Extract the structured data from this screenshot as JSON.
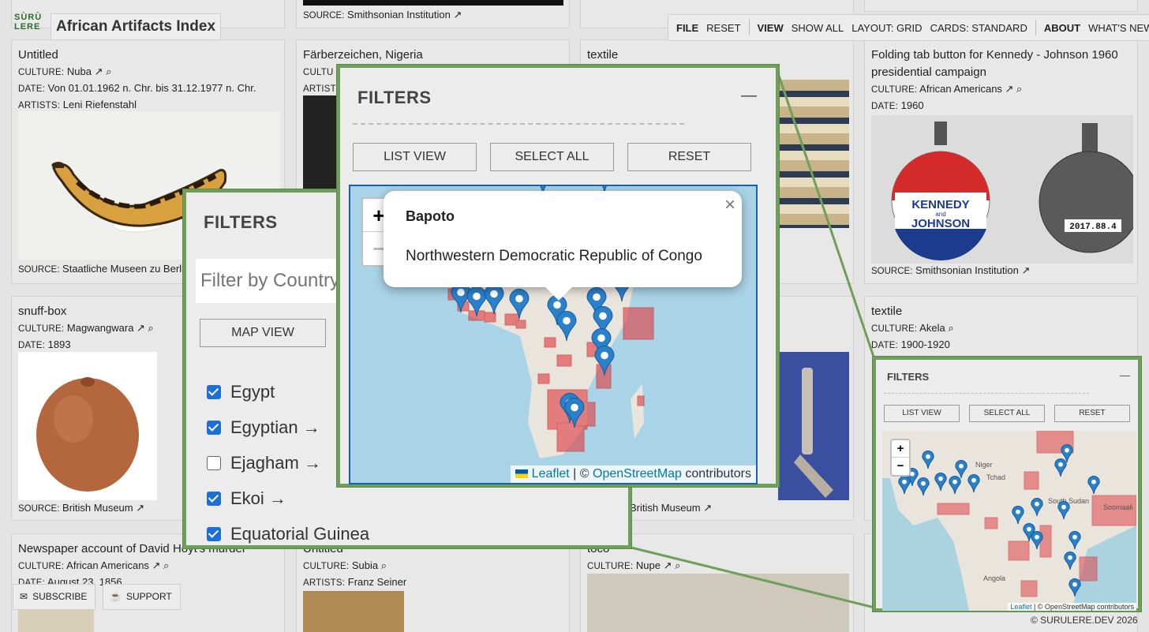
{
  "site": {
    "logo_line1": "SÙRÙ",
    "logo_line2": "LERE",
    "title": "African Artifacts Index"
  },
  "topbar": {
    "file": "FILE",
    "reset": "RESET",
    "view": "VIEW",
    "show_all": "SHOW ALL",
    "layout": "LAYOUT: GRID",
    "cards": "CARDS: STANDARD",
    "about": "ABOUT",
    "whats_new": "WHAT'S NEW"
  },
  "cards": {
    "c1": {
      "title": "Untitled",
      "culture_k": "CULTURE:",
      "culture": "Nuba",
      "date_k": "DATE:",
      "date": "Von 01.01.1962 n. Chr. bis 31.12.1977 n. Chr.",
      "artists_k": "ARTISTS:",
      "artists": "Leni Riefenstahl",
      "source_k": "SOURCE:",
      "source": "Staatliche Museen zu Berlin"
    },
    "c2": {
      "title": "Färberzeichen, Nigeria",
      "culture_k": "CULTU",
      "artists_k": "ARTIST"
    },
    "c3": {
      "title": "textile"
    },
    "c4": {
      "title": "Folding tab button for Kennedy - Johnson 1960 presidential campaign",
      "culture_k": "CULTURE:",
      "culture": "African Americans",
      "date_k": "DATE:",
      "date": "1960",
      "source_k": "SOURCE:",
      "source": "Smithsonian Institution",
      "btn_line1": "KENNEDY",
      "btn_and": "and",
      "btn_line2": "JOHNSON",
      "tag": "2017.88.4"
    },
    "c5": {
      "title": "snuff-box",
      "culture_k": "CULTURE:",
      "culture": "Magwangwara",
      "date_k": "DATE:",
      "date": "1893",
      "source_k": "SOURCE:",
      "source": "British Museum"
    },
    "c6": {
      "source": "British Museum"
    },
    "c7": {
      "title": "textile",
      "culture_k": "CULTURE:",
      "culture": "Akela",
      "date_k": "DATE:",
      "date": "1900-1920"
    },
    "c8": {
      "title": "Newspaper account of David Hoyt's murder",
      "culture_k": "CULTURE:",
      "culture": "African Americans",
      "date_k": "DATE:",
      "date": "August 23, 1856"
    },
    "c9": {
      "title": "Untitled",
      "culture_k": "CULTURE:",
      "culture": "Subia",
      "artists_k": "ARTISTS:",
      "artists": "Franz Seiner"
    },
    "c10": {
      "title": "toco",
      "culture_k": "CULTURE:",
      "culture": "Nupe"
    },
    "top_source": {
      "k": "SOURCE:",
      "v": "Smithsonian Institution"
    }
  },
  "bottom": {
    "subscribe": "SUBSCRIBE",
    "support": "SUPPORT",
    "copyright": "© SURULERE.DEV 2026"
  },
  "filters_left": {
    "title": "FILTERS",
    "placeholder": "Filter by Country",
    "map_view": "MAP VIEW",
    "items": [
      {
        "label": "Egypt",
        "checked": true
      },
      {
        "label": "Egyptian →",
        "checked": true
      },
      {
        "label": "Ejagham →",
        "checked": false
      },
      {
        "label": "Ekoi →",
        "checked": true
      },
      {
        "label": "Equatorial Guinea",
        "checked": true
      }
    ]
  },
  "filters_zoom": {
    "title": "FILTERS",
    "minimize": "—",
    "list_view": "LIST VIEW",
    "select_all": "SELECT ALL",
    "reset": "RESET",
    "zoom_in": "+",
    "zoom_out": "−",
    "popup_title": "Bapoto",
    "popup_body": "Northwestern Democratic Republic of Congo",
    "popup_close": "×",
    "attrib_leaflet": "Leaflet",
    "attrib_sep": " | © ",
    "attrib_osm": "OpenStreetMap",
    "attrib_tail": " contributors"
  },
  "filters_small": {
    "title": "FILTERS",
    "minimize": "—",
    "list_view": "LIST VIEW",
    "select_all": "SELECT ALL",
    "reset": "RESET",
    "zoom_in": "+",
    "zoom_out": "−",
    "map_labels": [
      "Niger",
      "Tchad",
      "South Sudan",
      "Angola",
      "Soomaali"
    ],
    "attrib_leaflet": "Leaflet",
    "attrib_osm": "© OpenStreetMap contributors"
  },
  "colors": {
    "accent_green": "#6f9f5a",
    "marker_blue": "#2a81cb",
    "region_red": "#e0454a"
  }
}
